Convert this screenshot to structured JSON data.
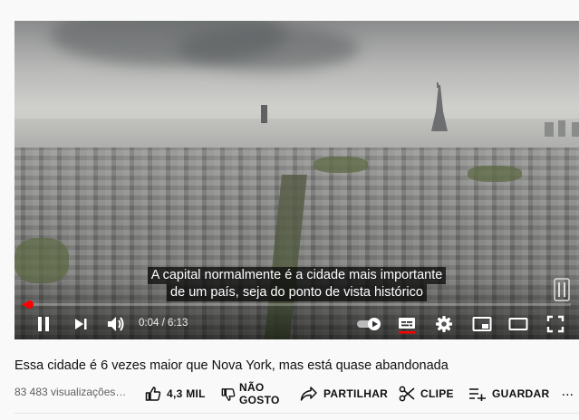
{
  "video": {
    "subtitle_line1": "A capital normalmente é a cidade mais importante",
    "subtitle_line2": "de um país, seja do ponto de vista histórico",
    "current_time": "0:04",
    "duration": "6:13",
    "time_separator": " / ",
    "progress_fraction": 0.011
  },
  "controls": {
    "play_pause_icon": "pause-icon",
    "next_icon": "next-icon",
    "volume_icon": "volume-icon",
    "autoplay_icon": "autoplay-toggle-icon",
    "captions_icon": "captions-icon",
    "settings_icon": "gear-icon",
    "miniplayer_icon": "miniplayer-icon",
    "theater_icon": "theater-mode-icon",
    "fullscreen_icon": "fullscreen-icon"
  },
  "info": {
    "title": "Essa cidade é 6 vezes maior que Nova York, mas está quase abandonada",
    "views": "83 483 visualizações…",
    "like_label": "4,3 MIL",
    "dislike_label_1": "NÃO",
    "dislike_label_2": "GOSTO",
    "share_label": "PARTILHAR",
    "clip_label": "CLIPE",
    "save_label": "GUARDAR",
    "more_label": "..."
  },
  "colors": {
    "accent": "#ff0000",
    "text": "#0f0f0f",
    "secondary_text": "#606060",
    "background": "#f9f9f9"
  }
}
